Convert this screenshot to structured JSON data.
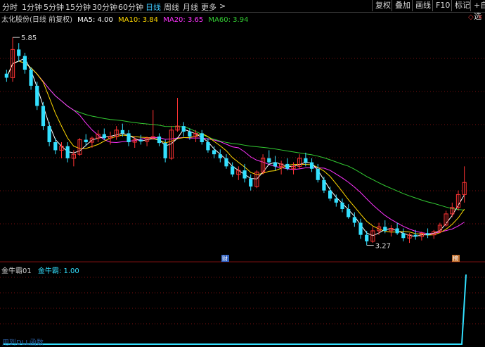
{
  "toolbar": {
    "periods": [
      {
        "label": "分时"
      },
      {
        "label": "1分钟"
      },
      {
        "label": "5分钟"
      },
      {
        "label": "15分钟"
      },
      {
        "label": "30分钟"
      },
      {
        "label": "60分钟"
      },
      {
        "label": "日线"
      },
      {
        "label": "周线"
      },
      {
        "label": "月线"
      },
      {
        "label": "更多"
      }
    ],
    "active_period": "日线",
    "more_arrow": ">",
    "buttons": [
      {
        "label": "复权"
      },
      {
        "label": "叠加"
      },
      {
        "label": "画线"
      },
      {
        "label": "F10"
      },
      {
        "label": "标记"
      },
      {
        "label": "+自选"
      }
    ]
  },
  "legend": {
    "title": "太化股份(日线 前复权)",
    "ma5": "MA5: 4.00",
    "ma10": "MA10: 3.84",
    "ma20": "MA20: 3.65",
    "ma60": "MA60: 3.94"
  },
  "colors": {
    "up": "#ff3333",
    "down": "#33e0ff",
    "ma5": "#ffffff",
    "ma10": "#ffd800",
    "ma20": "#ff33ff",
    "ma60": "#33cc33",
    "indicator": "#33e0ff",
    "grid": "#7a1010"
  },
  "annotations": {
    "high": "5.85",
    "low": "3.27",
    "badge1": "财",
    "badge2": "榜"
  },
  "sub": {
    "name": "金牛霸01",
    "value_label": "金牛霸: 1.00"
  },
  "footer": "用到DLL函数",
  "chart_data": {
    "type": "candlestick",
    "high_label": 5.85,
    "low_label": 3.27,
    "ma_last": {
      "MA5": 4.0,
      "MA10": 3.84,
      "MA20": 3.65,
      "MA60": 3.94
    },
    "ohlc": [
      [
        5.4,
        5.45,
        5.3,
        5.35
      ],
      [
        5.35,
        5.85,
        5.3,
        5.7
      ],
      [
        5.7,
        5.78,
        5.55,
        5.62
      ],
      [
        5.62,
        5.66,
        5.4,
        5.45
      ],
      [
        5.45,
        5.48,
        5.2,
        5.25
      ],
      [
        5.25,
        5.3,
        4.95,
        5.0
      ],
      [
        5.0,
        5.05,
        4.7,
        4.75
      ],
      [
        4.75,
        4.8,
        4.5,
        4.55
      ],
      [
        4.55,
        4.6,
        4.4,
        4.45
      ],
      [
        4.45,
        4.55,
        4.35,
        4.5
      ],
      [
        4.5,
        4.55,
        4.3,
        4.35
      ],
      [
        4.35,
        4.45,
        4.25,
        4.4
      ],
      [
        4.4,
        4.6,
        4.38,
        4.58
      ],
      [
        4.58,
        4.65,
        4.5,
        4.55
      ],
      [
        4.55,
        4.62,
        4.48,
        4.6
      ],
      [
        4.6,
        4.7,
        4.55,
        4.65
      ],
      [
        4.65,
        4.72,
        4.58,
        4.6
      ],
      [
        4.6,
        4.68,
        4.52,
        4.62
      ],
      [
        4.62,
        4.75,
        4.58,
        4.7
      ],
      [
        4.7,
        4.78,
        4.62,
        4.66
      ],
      [
        4.66,
        4.7,
        4.5,
        4.55
      ],
      [
        4.55,
        4.62,
        4.48,
        4.58
      ],
      [
        4.58,
        4.64,
        4.52,
        4.56
      ],
      [
        4.56,
        4.62,
        4.5,
        4.6
      ],
      [
        4.6,
        4.95,
        4.58,
        4.62
      ],
      [
        4.62,
        4.66,
        4.5,
        4.54
      ],
      [
        4.54,
        4.58,
        4.3,
        4.35
      ],
      [
        4.35,
        4.75,
        4.33,
        4.7
      ],
      [
        4.7,
        5.1,
        4.68,
        4.75
      ],
      [
        4.75,
        4.8,
        4.62,
        4.68
      ],
      [
        4.68,
        4.72,
        4.58,
        4.62
      ],
      [
        4.62,
        4.7,
        4.55,
        4.66
      ],
      [
        4.66,
        4.7,
        4.52,
        4.55
      ],
      [
        4.55,
        4.6,
        4.42,
        4.45
      ],
      [
        4.45,
        4.5,
        4.35,
        4.4
      ],
      [
        4.4,
        4.46,
        4.3,
        4.35
      ],
      [
        4.35,
        4.4,
        4.22,
        4.25
      ],
      [
        4.25,
        4.3,
        4.12,
        4.15
      ],
      [
        4.15,
        4.25,
        4.08,
        4.2
      ],
      [
        4.2,
        4.28,
        4.05,
        4.1
      ],
      [
        4.1,
        4.15,
        3.95,
        4.0
      ],
      [
        4.0,
        4.2,
        3.98,
        4.18
      ],
      [
        4.18,
        4.4,
        4.15,
        4.35
      ],
      [
        4.35,
        4.45,
        4.28,
        4.3
      ],
      [
        4.3,
        4.38,
        4.2,
        4.25
      ],
      [
        4.25,
        4.32,
        4.15,
        4.28
      ],
      [
        4.28,
        4.35,
        4.2,
        4.22
      ],
      [
        4.22,
        4.3,
        4.15,
        4.25
      ],
      [
        4.25,
        4.4,
        4.22,
        4.35
      ],
      [
        4.35,
        4.42,
        4.25,
        4.3
      ],
      [
        4.3,
        4.35,
        4.18,
        4.22
      ],
      [
        4.22,
        4.28,
        4.05,
        4.08
      ],
      [
        4.08,
        4.12,
        3.92,
        3.95
      ],
      [
        3.95,
        4.0,
        3.82,
        3.85
      ],
      [
        3.85,
        3.9,
        3.75,
        3.8
      ],
      [
        3.8,
        3.85,
        3.68,
        3.72
      ],
      [
        3.72,
        3.78,
        3.6,
        3.62
      ],
      [
        3.62,
        3.68,
        3.5,
        3.55
      ],
      [
        3.55,
        3.6,
        3.35,
        3.4
      ],
      [
        3.4,
        3.45,
        3.27,
        3.32
      ],
      [
        3.32,
        3.5,
        3.3,
        3.45
      ],
      [
        3.45,
        3.55,
        3.4,
        3.5
      ],
      [
        3.5,
        3.58,
        3.42,
        3.45
      ],
      [
        3.45,
        3.52,
        3.38,
        3.48
      ],
      [
        3.48,
        3.55,
        3.4,
        3.42
      ],
      [
        3.42,
        3.48,
        3.32,
        3.36
      ],
      [
        3.36,
        3.42,
        3.3,
        3.4
      ],
      [
        3.4,
        3.46,
        3.34,
        3.38
      ],
      [
        3.38,
        3.44,
        3.33,
        3.42
      ],
      [
        3.42,
        3.48,
        3.36,
        3.4
      ],
      [
        3.4,
        3.46,
        3.35,
        3.44
      ],
      [
        3.44,
        3.55,
        3.42,
        3.52
      ],
      [
        3.52,
        3.7,
        3.5,
        3.66
      ],
      [
        3.66,
        3.8,
        3.62,
        3.74
      ],
      [
        3.74,
        3.95,
        3.7,
        3.9
      ],
      [
        3.9,
        4.25,
        3.8,
        4.05
      ]
    ],
    "indicator": {
      "values": [
        0,
        0,
        0,
        0,
        0,
        0,
        0,
        0,
        0,
        0,
        1
      ]
    }
  }
}
